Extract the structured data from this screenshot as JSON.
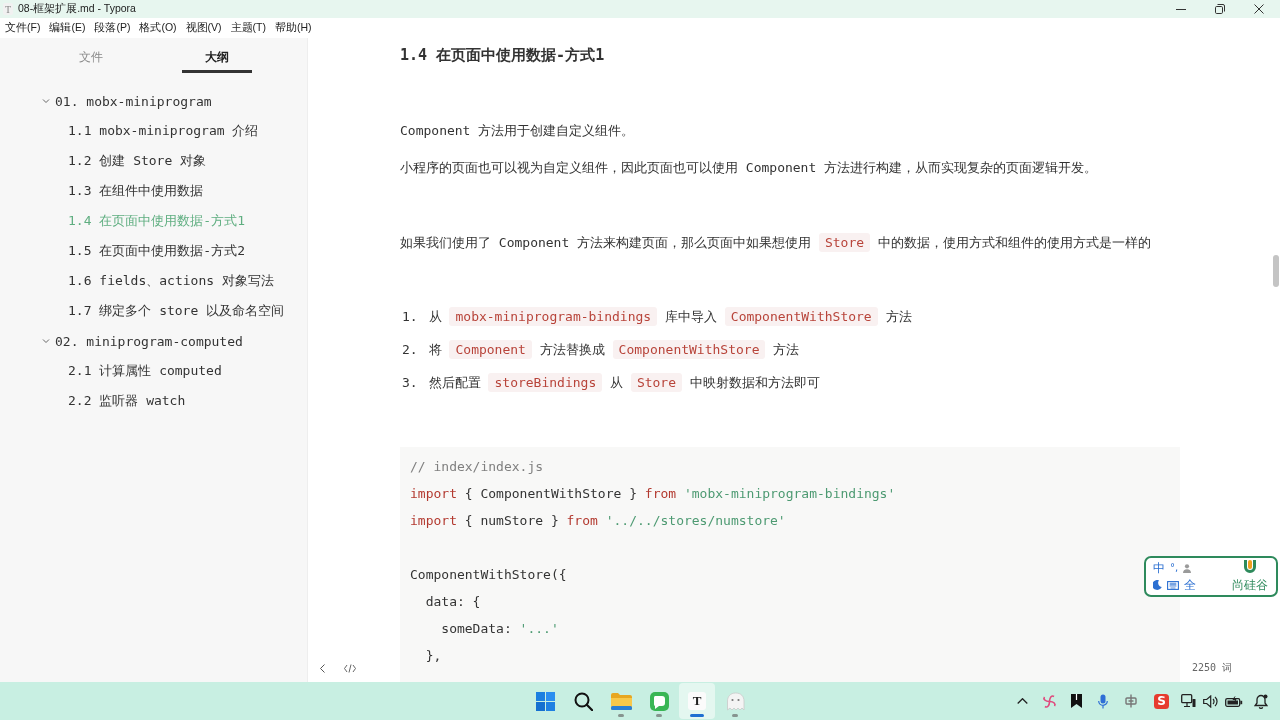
{
  "window": {
    "app_glyph": "T",
    "title": "08-框架扩展.md - Typora"
  },
  "menu_bar": [
    "文件(F)",
    "编辑(E)",
    "段落(P)",
    "格式(O)",
    "视图(V)",
    "主题(T)",
    "帮助(H)"
  ],
  "sidebar": {
    "tabs": [
      {
        "label": "文件",
        "selected": false
      },
      {
        "label": "大纲",
        "selected": true
      }
    ],
    "outline": [
      {
        "label": "01. mobx-miniprogram",
        "expanded": true,
        "selected": false,
        "children": [
          {
            "label": "1.1 mobx-miniprogram 介绍",
            "selected": false
          },
          {
            "label": "1.2 创建 Store 对象",
            "selected": false
          },
          {
            "label": "1.3 在组件中使用数据",
            "selected": false
          },
          {
            "label": "1.4 在页面中使用数据-方式1",
            "selected": true
          },
          {
            "label": "1.5 在页面中使用数据-方式2",
            "selected": false
          },
          {
            "label": "1.6 fields、actions 对象写法",
            "selected": false
          },
          {
            "label": "1.7 绑定多个 store 以及命名空间",
            "selected": false
          }
        ]
      },
      {
        "label": "02. miniprogram-computed",
        "expanded": true,
        "selected": false,
        "children": [
          {
            "label": "2.1 计算属性 computed",
            "selected": false
          },
          {
            "label": "2.2 监听器 watch",
            "selected": false
          }
        ]
      }
    ]
  },
  "document": {
    "heading": "1.4 在页面中使用数据-方式1",
    "intro": [
      [
        {
          "text": "Component 方法用于创建自定义组件。",
          "kind": "text"
        }
      ],
      [
        {
          "text": "小程序的页面也可以视为自定义组件，因此页面也可以使用 Component 方法进行构建，从而实现复杂的页面逻辑开发。",
          "kind": "text"
        }
      ]
    ],
    "note": [
      {
        "text": "如果我们使用了 Component 方法来构建页面，那么页面中如果想使用",
        "kind": "text"
      },
      {
        "text": "Store",
        "kind": "code"
      },
      {
        "text": "中的数据，使用方式和组件的使用方式是一样的",
        "kind": "text"
      }
    ],
    "steps": [
      {
        "number": "1.",
        "segments": [
          {
            "text": "从",
            "kind": "text"
          },
          {
            "text": "mobx-miniprogram-bindings",
            "kind": "code"
          },
          {
            "text": "库中导入",
            "kind": "text"
          },
          {
            "text": "ComponentWithStore",
            "kind": "code"
          },
          {
            "text": "方法",
            "kind": "text"
          }
        ]
      },
      {
        "number": "2.",
        "segments": [
          {
            "text": "将",
            "kind": "text"
          },
          {
            "text": "Component",
            "kind": "code"
          },
          {
            "text": "方法替换成",
            "kind": "text"
          },
          {
            "text": "ComponentWithStore",
            "kind": "code"
          },
          {
            "text": "方法",
            "kind": "text"
          }
        ]
      },
      {
        "number": "3.",
        "segments": [
          {
            "text": "然后配置",
            "kind": "text"
          },
          {
            "text": "storeBindings",
            "kind": "code"
          },
          {
            "text": "从",
            "kind": "text"
          },
          {
            "text": "Store",
            "kind": "code"
          },
          {
            "text": "中映射数据和方法即可",
            "kind": "text"
          }
        ]
      }
    ],
    "code_block": {
      "groups": [
        [
          [
            {
              "text": "// index/index.js",
              "kind": "comment"
            }
          ],
          [
            {
              "text": "import",
              "kind": "keyword"
            },
            {
              "text": " { ComponentWithStore } ",
              "kind": "plain"
            },
            {
              "text": "from",
              "kind": "keyword"
            },
            {
              "text": " 'mobx-miniprogram-bindings'",
              "kind": "string"
            }
          ],
          [
            {
              "text": "import",
              "kind": "keyword"
            },
            {
              "text": " { numStore } ",
              "kind": "plain"
            },
            {
              "text": "from",
              "kind": "keyword"
            },
            {
              "text": " '../../stores/numstore'",
              "kind": "string"
            }
          ]
        ],
        [
          [
            {
              "text": "ComponentWithStore({",
              "kind": "plain"
            }
          ],
          [
            {
              "text": "  data: {",
              "kind": "plain"
            }
          ],
          [
            {
              "text": "    someData: ",
              "kind": "plain"
            },
            {
              "text": "'...'",
              "kind": "string"
            }
          ],
          [
            {
              "text": "  },",
              "kind": "plain"
            }
          ]
        ]
      ]
    }
  },
  "footer": {
    "word_count": "2250 词"
  },
  "ime_toolbar": {
    "mode": "中",
    "punctuation": "°,",
    "width_mode": "全",
    "brand": "尚硅谷"
  },
  "taskbar": {
    "apps": [
      {
        "kind": "start",
        "running": false,
        "active": false
      },
      {
        "kind": "search",
        "running": false,
        "active": false
      },
      {
        "kind": "files",
        "running": true,
        "active": false
      },
      {
        "kind": "chat",
        "running": true,
        "active": false
      },
      {
        "kind": "typora",
        "glyph": "T",
        "running": true,
        "active": true
      },
      {
        "kind": "ghost",
        "running": true,
        "active": false
      }
    ],
    "tray_app_glyph": "S"
  }
}
